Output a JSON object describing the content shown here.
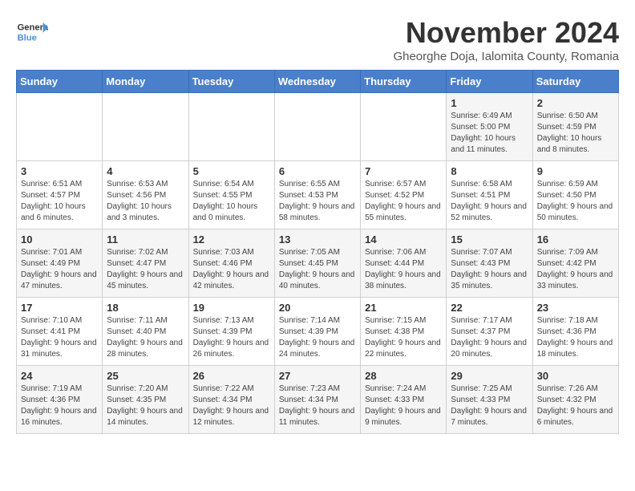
{
  "logo": {
    "text_general": "General",
    "text_blue": "Blue"
  },
  "header": {
    "month_title": "November 2024",
    "subtitle": "Gheorghe Doja, Ialomita County, Romania"
  },
  "weekdays": [
    "Sunday",
    "Monday",
    "Tuesday",
    "Wednesday",
    "Thursday",
    "Friday",
    "Saturday"
  ],
  "weeks": [
    [
      {
        "day": "",
        "info": ""
      },
      {
        "day": "",
        "info": ""
      },
      {
        "day": "",
        "info": ""
      },
      {
        "day": "",
        "info": ""
      },
      {
        "day": "",
        "info": ""
      },
      {
        "day": "1",
        "info": "Sunrise: 6:49 AM\nSunset: 5:00 PM\nDaylight: 10 hours and 11 minutes."
      },
      {
        "day": "2",
        "info": "Sunrise: 6:50 AM\nSunset: 4:59 PM\nDaylight: 10 hours and 8 minutes."
      }
    ],
    [
      {
        "day": "3",
        "info": "Sunrise: 6:51 AM\nSunset: 4:57 PM\nDaylight: 10 hours and 6 minutes."
      },
      {
        "day": "4",
        "info": "Sunrise: 6:53 AM\nSunset: 4:56 PM\nDaylight: 10 hours and 3 minutes."
      },
      {
        "day": "5",
        "info": "Sunrise: 6:54 AM\nSunset: 4:55 PM\nDaylight: 10 hours and 0 minutes."
      },
      {
        "day": "6",
        "info": "Sunrise: 6:55 AM\nSunset: 4:53 PM\nDaylight: 9 hours and 58 minutes."
      },
      {
        "day": "7",
        "info": "Sunrise: 6:57 AM\nSunset: 4:52 PM\nDaylight: 9 hours and 55 minutes."
      },
      {
        "day": "8",
        "info": "Sunrise: 6:58 AM\nSunset: 4:51 PM\nDaylight: 9 hours and 52 minutes."
      },
      {
        "day": "9",
        "info": "Sunrise: 6:59 AM\nSunset: 4:50 PM\nDaylight: 9 hours and 50 minutes."
      }
    ],
    [
      {
        "day": "10",
        "info": "Sunrise: 7:01 AM\nSunset: 4:49 PM\nDaylight: 9 hours and 47 minutes."
      },
      {
        "day": "11",
        "info": "Sunrise: 7:02 AM\nSunset: 4:47 PM\nDaylight: 9 hours and 45 minutes."
      },
      {
        "day": "12",
        "info": "Sunrise: 7:03 AM\nSunset: 4:46 PM\nDaylight: 9 hours and 42 minutes."
      },
      {
        "day": "13",
        "info": "Sunrise: 7:05 AM\nSunset: 4:45 PM\nDaylight: 9 hours and 40 minutes."
      },
      {
        "day": "14",
        "info": "Sunrise: 7:06 AM\nSunset: 4:44 PM\nDaylight: 9 hours and 38 minutes."
      },
      {
        "day": "15",
        "info": "Sunrise: 7:07 AM\nSunset: 4:43 PM\nDaylight: 9 hours and 35 minutes."
      },
      {
        "day": "16",
        "info": "Sunrise: 7:09 AM\nSunset: 4:42 PM\nDaylight: 9 hours and 33 minutes."
      }
    ],
    [
      {
        "day": "17",
        "info": "Sunrise: 7:10 AM\nSunset: 4:41 PM\nDaylight: 9 hours and 31 minutes."
      },
      {
        "day": "18",
        "info": "Sunrise: 7:11 AM\nSunset: 4:40 PM\nDaylight: 9 hours and 28 minutes."
      },
      {
        "day": "19",
        "info": "Sunrise: 7:13 AM\nSunset: 4:39 PM\nDaylight: 9 hours and 26 minutes."
      },
      {
        "day": "20",
        "info": "Sunrise: 7:14 AM\nSunset: 4:39 PM\nDaylight: 9 hours and 24 minutes."
      },
      {
        "day": "21",
        "info": "Sunrise: 7:15 AM\nSunset: 4:38 PM\nDaylight: 9 hours and 22 minutes."
      },
      {
        "day": "22",
        "info": "Sunrise: 7:17 AM\nSunset: 4:37 PM\nDaylight: 9 hours and 20 minutes."
      },
      {
        "day": "23",
        "info": "Sunrise: 7:18 AM\nSunset: 4:36 PM\nDaylight: 9 hours and 18 minutes."
      }
    ],
    [
      {
        "day": "24",
        "info": "Sunrise: 7:19 AM\nSunset: 4:36 PM\nDaylight: 9 hours and 16 minutes."
      },
      {
        "day": "25",
        "info": "Sunrise: 7:20 AM\nSunset: 4:35 PM\nDaylight: 9 hours and 14 minutes."
      },
      {
        "day": "26",
        "info": "Sunrise: 7:22 AM\nSunset: 4:34 PM\nDaylight: 9 hours and 12 minutes."
      },
      {
        "day": "27",
        "info": "Sunrise: 7:23 AM\nSunset: 4:34 PM\nDaylight: 9 hours and 11 minutes."
      },
      {
        "day": "28",
        "info": "Sunrise: 7:24 AM\nSunset: 4:33 PM\nDaylight: 9 hours and 9 minutes."
      },
      {
        "day": "29",
        "info": "Sunrise: 7:25 AM\nSunset: 4:33 PM\nDaylight: 9 hours and 7 minutes."
      },
      {
        "day": "30",
        "info": "Sunrise: 7:26 AM\nSunset: 4:32 PM\nDaylight: 9 hours and 6 minutes."
      }
    ]
  ]
}
